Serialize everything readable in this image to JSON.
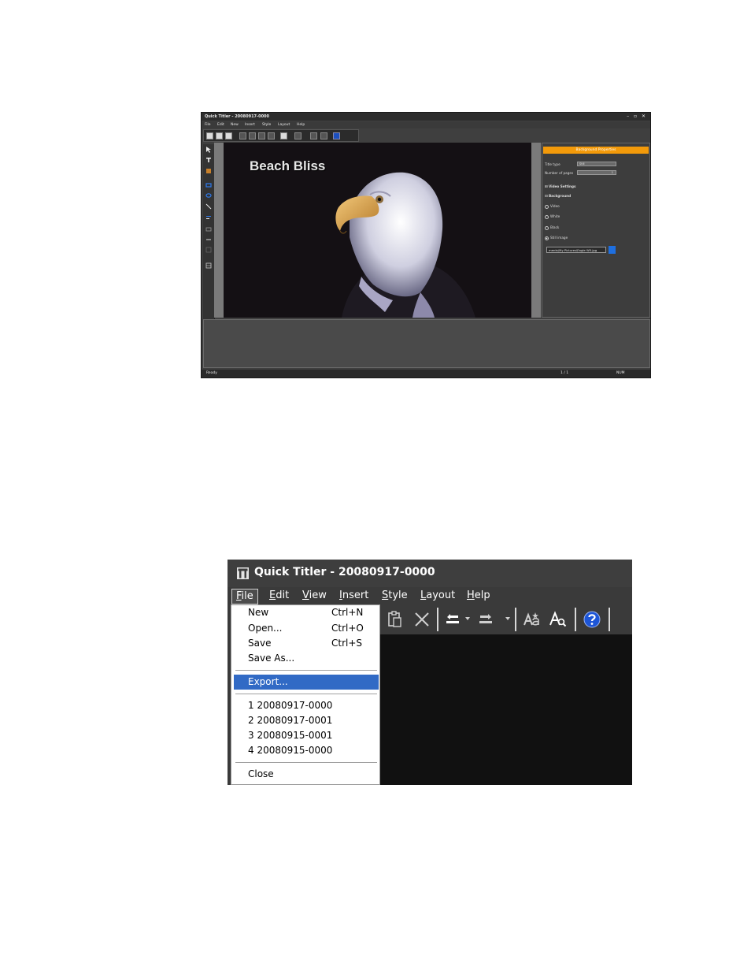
{
  "screenshot1": {
    "window_title": "Quick Titler - 20080917-0000",
    "window_controls": "– ▫ ✕",
    "menu": [
      "File",
      "Edit",
      "New",
      "Insert",
      "Style",
      "Layout",
      "Help"
    ],
    "canvas_title_text": "Beach Bliss",
    "properties": {
      "header": "Background Properties",
      "title_type_label": "Title type",
      "title_type_value": "Still",
      "pages_label": "Number of pages",
      "pages_value": "1",
      "video_settings": "Video Settings",
      "background": "Background",
      "options": [
        "Video",
        "White",
        "Black",
        "Still image"
      ],
      "selected_option": "Still image",
      "image_path": "ments\\My Pictures\\Eagle W5.jpg"
    },
    "status": {
      "left": "Ready",
      "page": "1 / 1",
      "mode": "NUM"
    }
  },
  "screenshot2": {
    "window_title": "Quick Titler - 20080917-0000",
    "menu": [
      {
        "label": "File",
        "underline": "F",
        "rest": "ile"
      },
      {
        "label": "Edit",
        "underline": "E",
        "rest": "dit"
      },
      {
        "label": "View",
        "underline": "V",
        "rest": "iew"
      },
      {
        "label": "Insert",
        "underline": "I",
        "rest": "nsert"
      },
      {
        "label": "Style",
        "underline": "S",
        "rest": "tyle"
      },
      {
        "label": "Layout",
        "underline": "L",
        "rest": "ayout"
      },
      {
        "label": "Help",
        "underline": "H",
        "rest": "elp"
      }
    ],
    "file_menu": {
      "new": {
        "label": "New",
        "shortcut": "Ctrl+N"
      },
      "open": {
        "label": "Open...",
        "shortcut": "Ctrl+O"
      },
      "save": {
        "label": "Save",
        "shortcut": "Ctrl+S"
      },
      "save_as": {
        "label": "Save As..."
      },
      "export": {
        "label": "Export..."
      },
      "recent": [
        "1 20080917-0000",
        "2 20080917-0001",
        "3 20080915-0001",
        "4 20080915-0000"
      ],
      "close": {
        "label": "Close"
      }
    },
    "highlight_color": "#316ac5"
  }
}
